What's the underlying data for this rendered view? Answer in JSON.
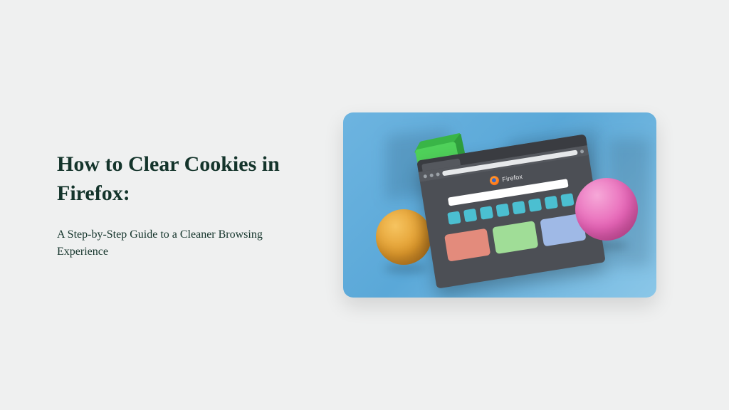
{
  "title": "How to Clear Cookies in Firefox:",
  "subtitle": "A Step-by-Step Guide to a Cleaner Browsing Experience",
  "illustration": {
    "browser_brand": "Firefox"
  }
}
